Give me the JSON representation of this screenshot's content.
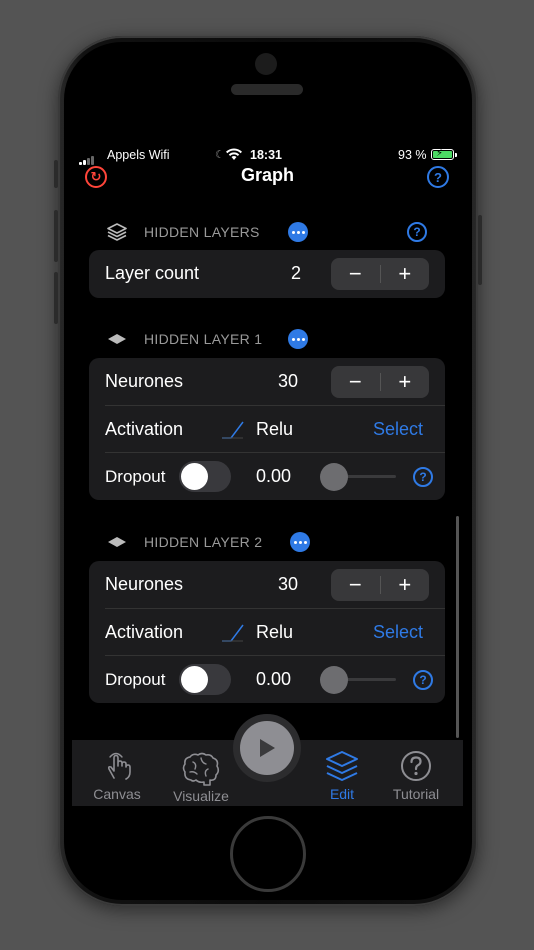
{
  "status": {
    "carrier": "Appels Wifi",
    "time": "18:31",
    "battery": "93 %"
  },
  "nav": {
    "title": "Graph",
    "refresh_icon": "refresh-icon",
    "help_icon": "help-icon"
  },
  "hidden_layers": {
    "header": "HIDDEN LAYERS",
    "layer_count_label": "Layer count",
    "layer_count_value": "2"
  },
  "layers": [
    {
      "header": "HIDDEN LAYER 1",
      "neurones_label": "Neurones",
      "neurones_value": "30",
      "activation_label": "Activation",
      "activation_value": "Relu",
      "select_label": "Select",
      "dropout_label": "Dropout",
      "dropout_value": "0.00",
      "dropout_enabled": false,
      "dropout_level": 0
    },
    {
      "header": "HIDDEN LAYER 2",
      "neurones_label": "Neurones",
      "neurones_value": "30",
      "activation_label": "Activation",
      "activation_value": "Relu",
      "select_label": "Select",
      "dropout_label": "Dropout",
      "dropout_value": "0.00",
      "dropout_enabled": false,
      "dropout_level": 0
    }
  ],
  "stepper": {
    "minus": "−",
    "plus": "+"
  },
  "tabs": [
    {
      "label": "Canvas",
      "icon": "hand-tap-icon",
      "active": false
    },
    {
      "label": "Visualize",
      "icon": "brain-icon",
      "active": false
    },
    {
      "label": "Edit",
      "icon": "layers-icon",
      "active": true
    },
    {
      "label": "Tutorial",
      "icon": "question-icon",
      "active": false
    }
  ],
  "colors": {
    "accent": "#2f7ae5",
    "destructive": "#ff453a",
    "card": "#1c1c1e"
  }
}
